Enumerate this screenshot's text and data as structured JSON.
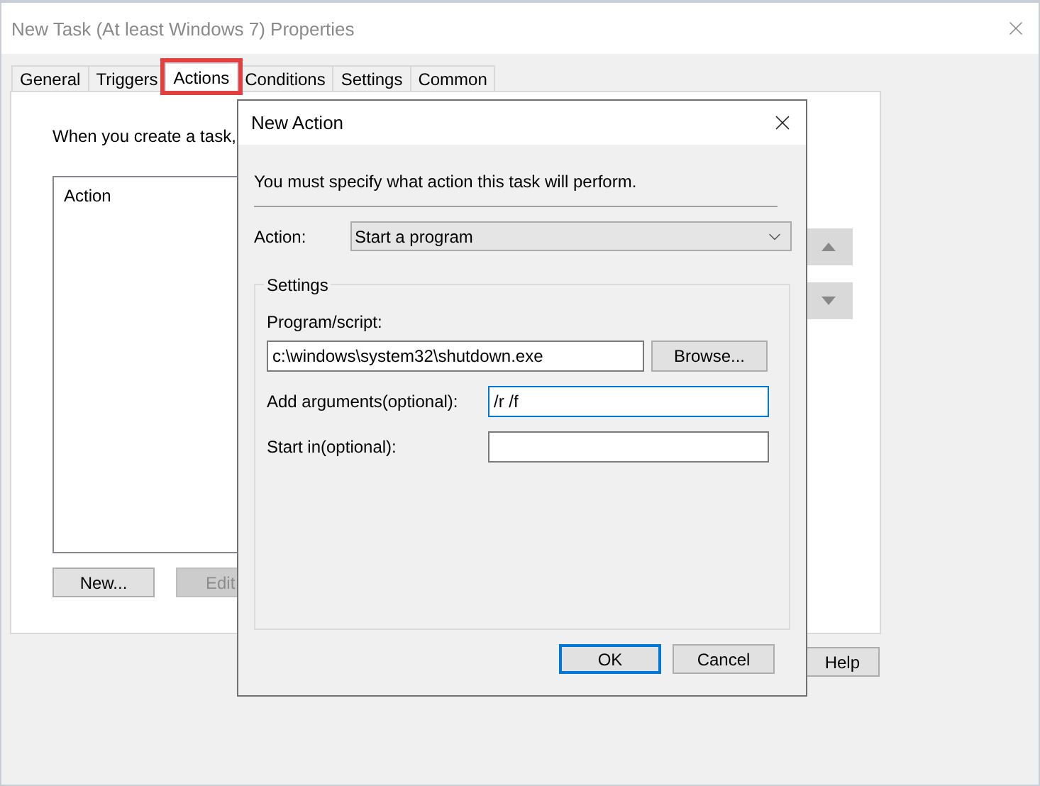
{
  "window": {
    "title": "New Task (At least Windows 7) Properties"
  },
  "tabs": [
    {
      "label": "General",
      "selected": false,
      "highlighted": false
    },
    {
      "label": "Triggers",
      "selected": false,
      "highlighted": false
    },
    {
      "label": "Actions",
      "selected": true,
      "highlighted": true
    },
    {
      "label": "Conditions",
      "selected": false,
      "highlighted": false
    },
    {
      "label": "Settings",
      "selected": false,
      "highlighted": false
    },
    {
      "label": "Common",
      "selected": false,
      "highlighted": false
    }
  ],
  "actions_panel": {
    "intro": "When you create a task,",
    "list_header": "Action",
    "buttons": [
      {
        "label": "New...",
        "disabled": false
      },
      {
        "label": "Edit",
        "disabled": true
      }
    ]
  },
  "footer_buttons": [
    {
      "label": "Help"
    }
  ],
  "dialog": {
    "title": "New Action",
    "instruction": "You must specify what action this task will perform.",
    "action_label": "Action:",
    "action_value": "Start a program",
    "group_title": "Settings",
    "program_label": "Program/script:",
    "program_value": "c:\\windows\\system32\\shutdown.exe",
    "browse": "Browse...",
    "fields": [
      {
        "label": "Add arguments(optional):",
        "value": "/r /f",
        "focused": true
      },
      {
        "label": "Start in(optional):",
        "focused": false
      }
    ],
    "buttons": [
      {
        "label": "OK",
        "default": true
      },
      {
        "label": "Cancel",
        "default": false
      }
    ]
  }
}
